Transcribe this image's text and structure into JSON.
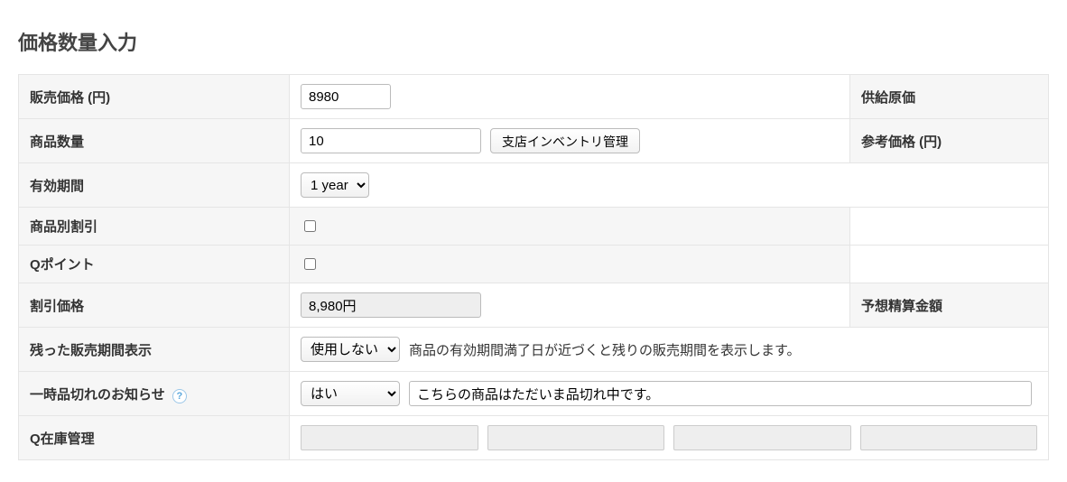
{
  "title": "価格数量入力",
  "rows": {
    "price": {
      "label": "販売価格 (円)",
      "value": "8980",
      "side_label": "供給原価"
    },
    "qty": {
      "label": "商品数量",
      "value": "10",
      "button": "支店インベントリ管理",
      "side_label": "参考価格 (円)"
    },
    "valid": {
      "label": "有効期間",
      "value": "1 year"
    },
    "item_disc": {
      "label": "商品別割引"
    },
    "qpoint": {
      "label": "Qポイント"
    },
    "disc_price": {
      "label": "割引価格",
      "value": "8,980円",
      "side_label": "予想精算金額"
    },
    "remain": {
      "label": "残った販売期間表示",
      "value": "使用しない",
      "note": "商品の有効期間満了日が近づくと残りの販売期間を表示します。"
    },
    "soldout": {
      "label": "一時品切れのお知らせ",
      "value": "はい",
      "message": "こちらの商品はただいま品切れ中です。"
    },
    "qstock": {
      "label": "Q在庫管理"
    }
  }
}
